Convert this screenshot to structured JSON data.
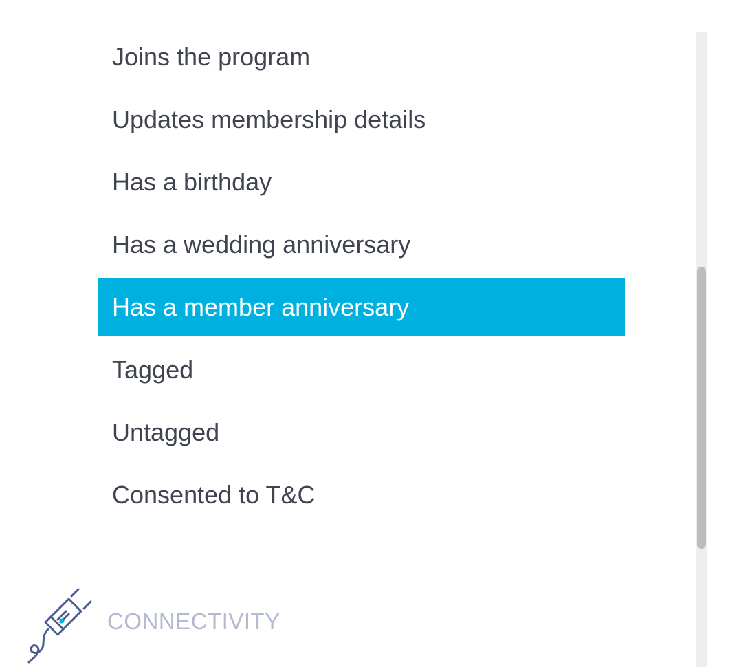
{
  "menu": {
    "items": [
      {
        "label": "Joins the program"
      },
      {
        "label": "Updates membership details"
      },
      {
        "label": "Has a birthday"
      },
      {
        "label": "Has a wedding anniversary"
      },
      {
        "label": "Has a member anniversary",
        "selected": true
      },
      {
        "label": "Tagged"
      },
      {
        "label": "Untagged"
      },
      {
        "label": "Consented to T&C"
      }
    ]
  },
  "section": {
    "label": "CONNECTIVITY",
    "icon": "plug-icon"
  },
  "colors": {
    "accent": "#00b1e0",
    "text": "#3f4450",
    "section_label": "#b4b9d2",
    "icon_stroke": "#4a5d8f"
  }
}
